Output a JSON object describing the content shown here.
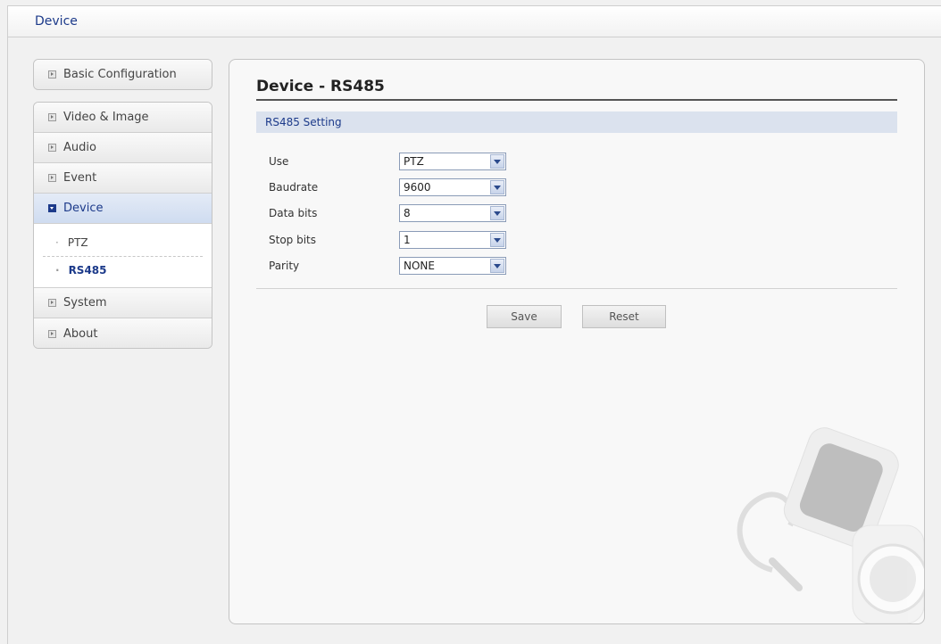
{
  "header": {
    "title": "Device"
  },
  "nav": {
    "basic": {
      "label": "Basic Configuration"
    },
    "items": [
      {
        "label": "Video & Image"
      },
      {
        "label": "Audio"
      },
      {
        "label": "Event"
      },
      {
        "label": "Device"
      },
      {
        "label": "System"
      },
      {
        "label": "About"
      }
    ],
    "device_sub": [
      {
        "label": "PTZ"
      },
      {
        "label": "RS485"
      }
    ]
  },
  "main": {
    "title": "Device - RS485",
    "section": "RS485 Setting",
    "fields": [
      {
        "label": "Use",
        "value": "PTZ"
      },
      {
        "label": "Baudrate",
        "value": "9600"
      },
      {
        "label": "Data bits",
        "value": "8"
      },
      {
        "label": "Stop bits",
        "value": "1"
      },
      {
        "label": "Parity",
        "value": "NONE"
      }
    ],
    "buttons": {
      "save": "Save",
      "reset": "Reset"
    }
  }
}
